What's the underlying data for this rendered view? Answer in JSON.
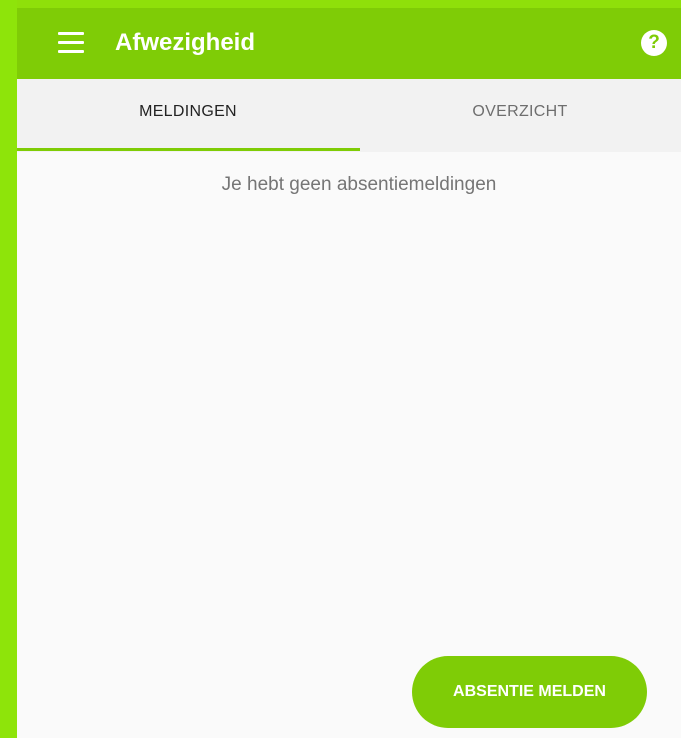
{
  "app": {
    "title": "Afwezigheid",
    "brand_color": "#7fcc06"
  },
  "icons": {
    "menu": "menu-icon",
    "help": "help-icon",
    "help_glyph": "?"
  },
  "tabs": [
    {
      "label": "MELDINGEN",
      "active": true
    },
    {
      "label": "OVERZICHT",
      "active": false
    }
  ],
  "content": {
    "empty_message": "Je hebt geen absentiemeldingen"
  },
  "actions": {
    "primary_button": "ABSENTIE MELDEN"
  }
}
